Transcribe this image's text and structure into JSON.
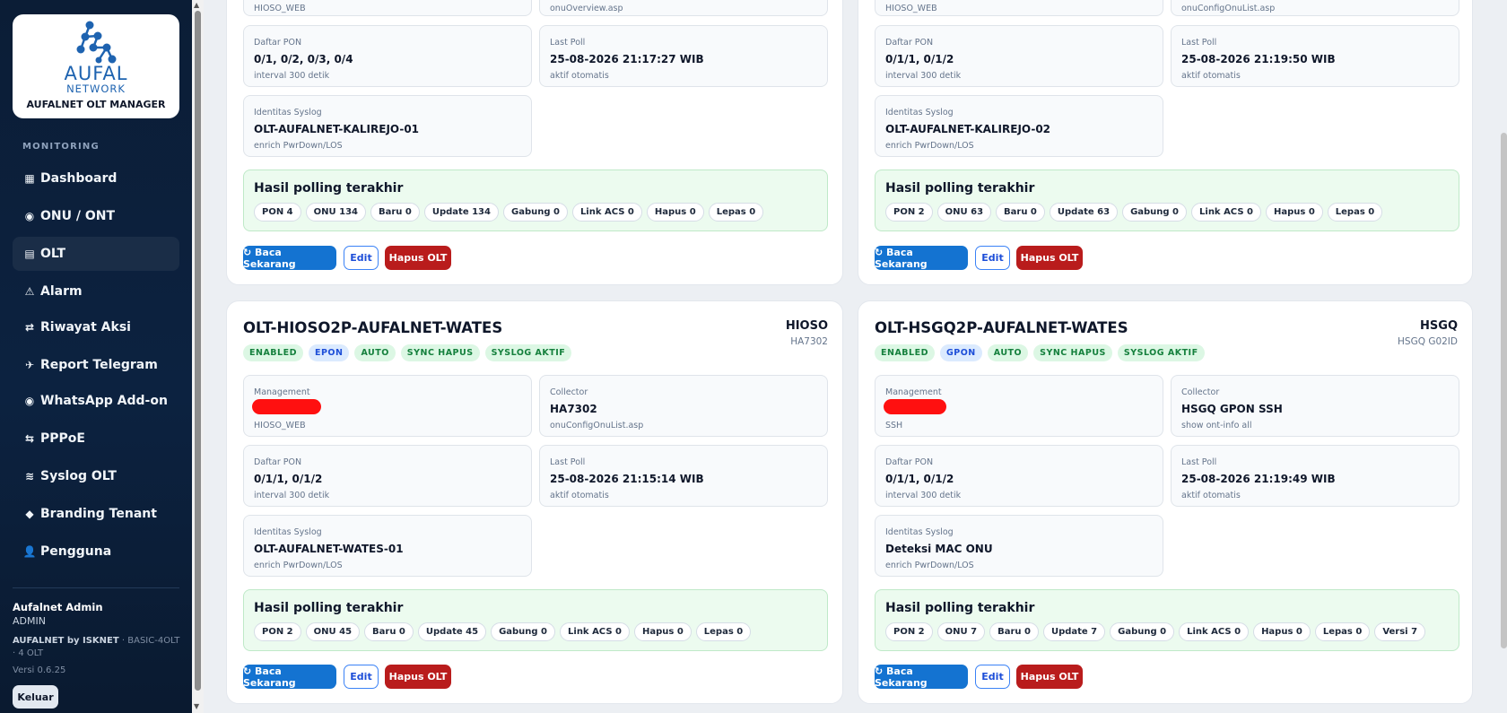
{
  "brand": {
    "logo_word": "AUFAL",
    "logo_sub": "NETWORK",
    "app_name": "AUFALNET OLT MANAGER"
  },
  "sidebar": {
    "section": "MONITORING",
    "items": [
      {
        "icon": "▦",
        "label": "Dashboard"
      },
      {
        "icon": "◉",
        "label": "ONU / ONT"
      },
      {
        "icon": "▤",
        "label": "OLT"
      },
      {
        "icon": "⚠",
        "label": "Alarm"
      },
      {
        "icon": "⇄",
        "label": "Riwayat Aksi"
      },
      {
        "icon": "✈",
        "label": "Report Telegram"
      },
      {
        "icon": "◉",
        "label": "WhatsApp Add-on"
      },
      {
        "icon": "⇆",
        "label": "PPPoE"
      },
      {
        "icon": "≋",
        "label": "Syslog OLT"
      },
      {
        "icon": "◆",
        "label": "Branding Tenant"
      },
      {
        "icon": "👤",
        "label": "Pengguna"
      }
    ],
    "active": "OLT",
    "user": {
      "name": "Aufalnet Admin",
      "role": "ADMIN"
    },
    "tenant_bold": "AUFALNET by ISKNET",
    "tenant_rest": " · BASIC-4OLT · 4 OLT",
    "version": "Versi 0.6.25",
    "logout": "Keluar"
  },
  "labels": {
    "management": "Management",
    "collector": "Collector",
    "pon_list": "Daftar PON",
    "last_poll": "Last Poll",
    "syslog_id": "Identitas Syslog",
    "poll_result": "Hasil polling terakhir",
    "btn_read": "↻ Baca Sekarang",
    "btn_edit": "Edit",
    "btn_delete": "Hapus OLT"
  },
  "cards": [
    {
      "mgmt_sub": "HIOSO_WEB",
      "collector_sub": "onuOverview.asp",
      "pon": "0/1, 0/2, 0/3, 0/4",
      "pon_sub": "interval 300 detik",
      "poll": "25-08-2026 21:17:27 WIB",
      "poll_sub": "aktif otomatis",
      "syslog": "OLT-AUFALNET-KALIREJO-01",
      "syslog_sub": "enrich PwrDown/LOS",
      "pills": [
        "PON 4",
        "ONU 134",
        "Baru 0",
        "Update 134",
        "Gabung 0",
        "Link ACS 0",
        "Hapus 0",
        "Lepas 0"
      ]
    },
    {
      "mgmt_sub": "HIOSO_WEB",
      "collector_sub": "onuConfigOnuList.asp",
      "pon": "0/1/1, 0/1/2",
      "pon_sub": "interval 300 detik",
      "poll": "25-08-2026 21:19:50 WIB",
      "poll_sub": "aktif otomatis",
      "syslog": "OLT-AUFALNET-KALIREJO-02",
      "syslog_sub": "enrich PwrDown/LOS",
      "pills": [
        "PON 2",
        "ONU 63",
        "Baru 0",
        "Update 63",
        "Gabung 0",
        "Link ACS 0",
        "Hapus 0",
        "Lepas 0"
      ]
    },
    {
      "title": "OLT-HIOSO2P-AUFALNET-WATES",
      "brand": "HIOSO",
      "model": "HA7302",
      "badges": [
        "ENABLED",
        "EPON",
        "AUTO",
        "SYNC HAPUS",
        "SYSLOG AKTIF"
      ],
      "mgmt_sub": "HIOSO_WEB",
      "collector": "HA7302",
      "collector_sub": "onuConfigOnuList.asp",
      "pon": "0/1/1, 0/1/2",
      "pon_sub": "interval 300 detik",
      "poll": "25-08-2026 21:15:14 WIB",
      "poll_sub": "aktif otomatis",
      "syslog": "OLT-AUFALNET-WATES-01",
      "syslog_sub": "enrich PwrDown/LOS",
      "pills": [
        "PON 2",
        "ONU 45",
        "Baru 0",
        "Update 45",
        "Gabung 0",
        "Link ACS 0",
        "Hapus 0",
        "Lepas 0"
      ]
    },
    {
      "title": "OLT-HSGQ2P-AUFALNET-WATES",
      "brand": "HSGQ",
      "model": "HSGQ G02ID",
      "badges": [
        "ENABLED",
        "GPON",
        "AUTO",
        "SYNC HAPUS",
        "SYSLOG AKTIF"
      ],
      "mgmt_sub": "SSH",
      "collector": "HSGQ GPON SSH",
      "collector_sub": "show ont-info all",
      "pon": "0/1/1, 0/1/2",
      "pon_sub": "interval 300 detik",
      "poll": "25-08-2026 21:19:49 WIB",
      "poll_sub": "aktif otomatis",
      "syslog": "Deteksi MAC ONU",
      "syslog_sub": "enrich PwrDown/LOS",
      "pills": [
        "PON 2",
        "ONU 7",
        "Baru 0",
        "Update 7",
        "Gabung 0",
        "Link ACS 0",
        "Hapus 0",
        "Lepas 0",
        "Versi 7"
      ]
    }
  ]
}
